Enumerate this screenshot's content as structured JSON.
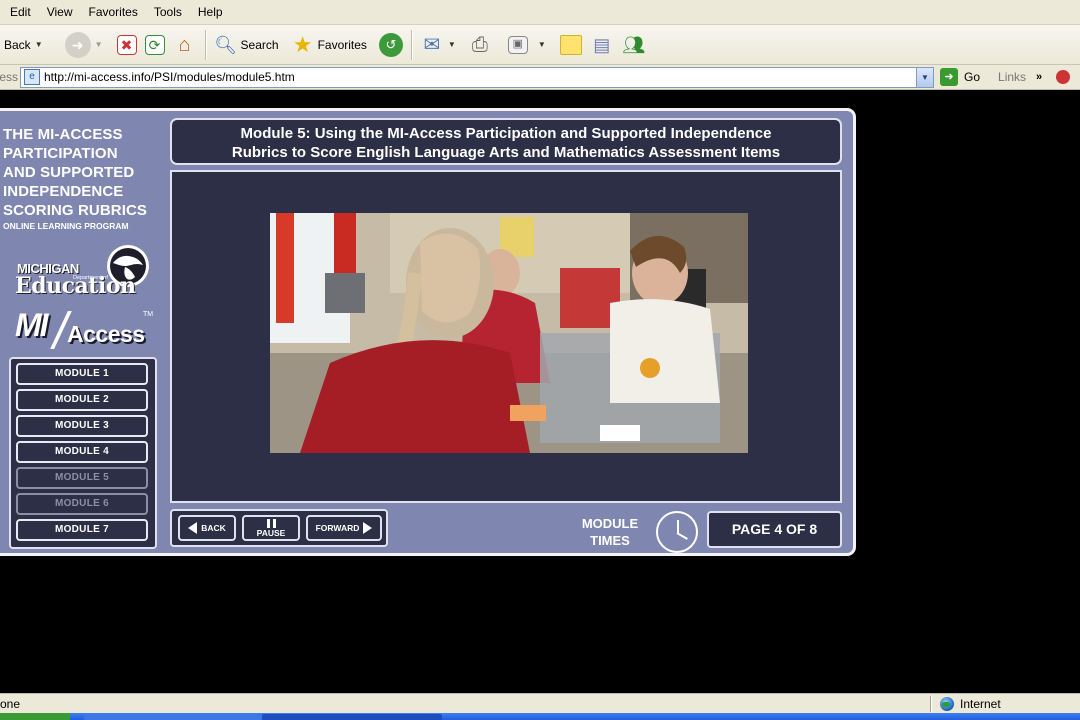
{
  "browser": {
    "menu": [
      "Edit",
      "View",
      "Favorites",
      "Tools",
      "Help"
    ],
    "toolbar": {
      "back_label": "Back",
      "search_label": "Search",
      "favorites_label": "Favorites"
    },
    "address": {
      "label": "ess",
      "url": "http://mi-access.info/PSI/modules/module5.htm",
      "go_label": "Go",
      "links_label": "Links"
    },
    "status": {
      "text": "one",
      "zone": "Internet"
    }
  },
  "player": {
    "program_title": [
      "THE MI-ACCESS",
      "PARTICIPATION",
      "AND SUPPORTED",
      "INDEPENDENCE",
      "SCORING RUBRICS"
    ],
    "program_subtitle": "ONLINE LEARNING PROGRAM",
    "mde_logo": {
      "michigan": "MICHIGAN",
      "dept": "Department of",
      "education": "Education"
    },
    "miaccess_logo": {
      "mi": "MI",
      "access": "Access",
      "tm": "TM"
    },
    "modules": [
      {
        "label": "MODULE 1",
        "active": true
      },
      {
        "label": "MODULE 2",
        "active": true
      },
      {
        "label": "MODULE 3",
        "active": true
      },
      {
        "label": "MODULE 4",
        "active": true
      },
      {
        "label": "MODULE 5",
        "active": false
      },
      {
        "label": "MODULE 6",
        "active": false
      },
      {
        "label": "MODULE 7",
        "active": true
      }
    ],
    "module_header": [
      "Module 5: Using the MI-Access Participation and Supported Independence",
      "Rubrics to Score English Language Arts and Mathematics Assessment Items"
    ],
    "controls": {
      "back": "BACK",
      "pause": "PAUSE",
      "forward": "FORWARD"
    },
    "module_times": [
      "MODULE",
      "TIMES"
    ],
    "page_indicator": "PAGE 4 OF 8"
  },
  "colors": {
    "panel": "#7f87b0",
    "dark_box": "#2c2f45",
    "border": "#dfe1ee",
    "inactive": "#8b8fa6"
  }
}
